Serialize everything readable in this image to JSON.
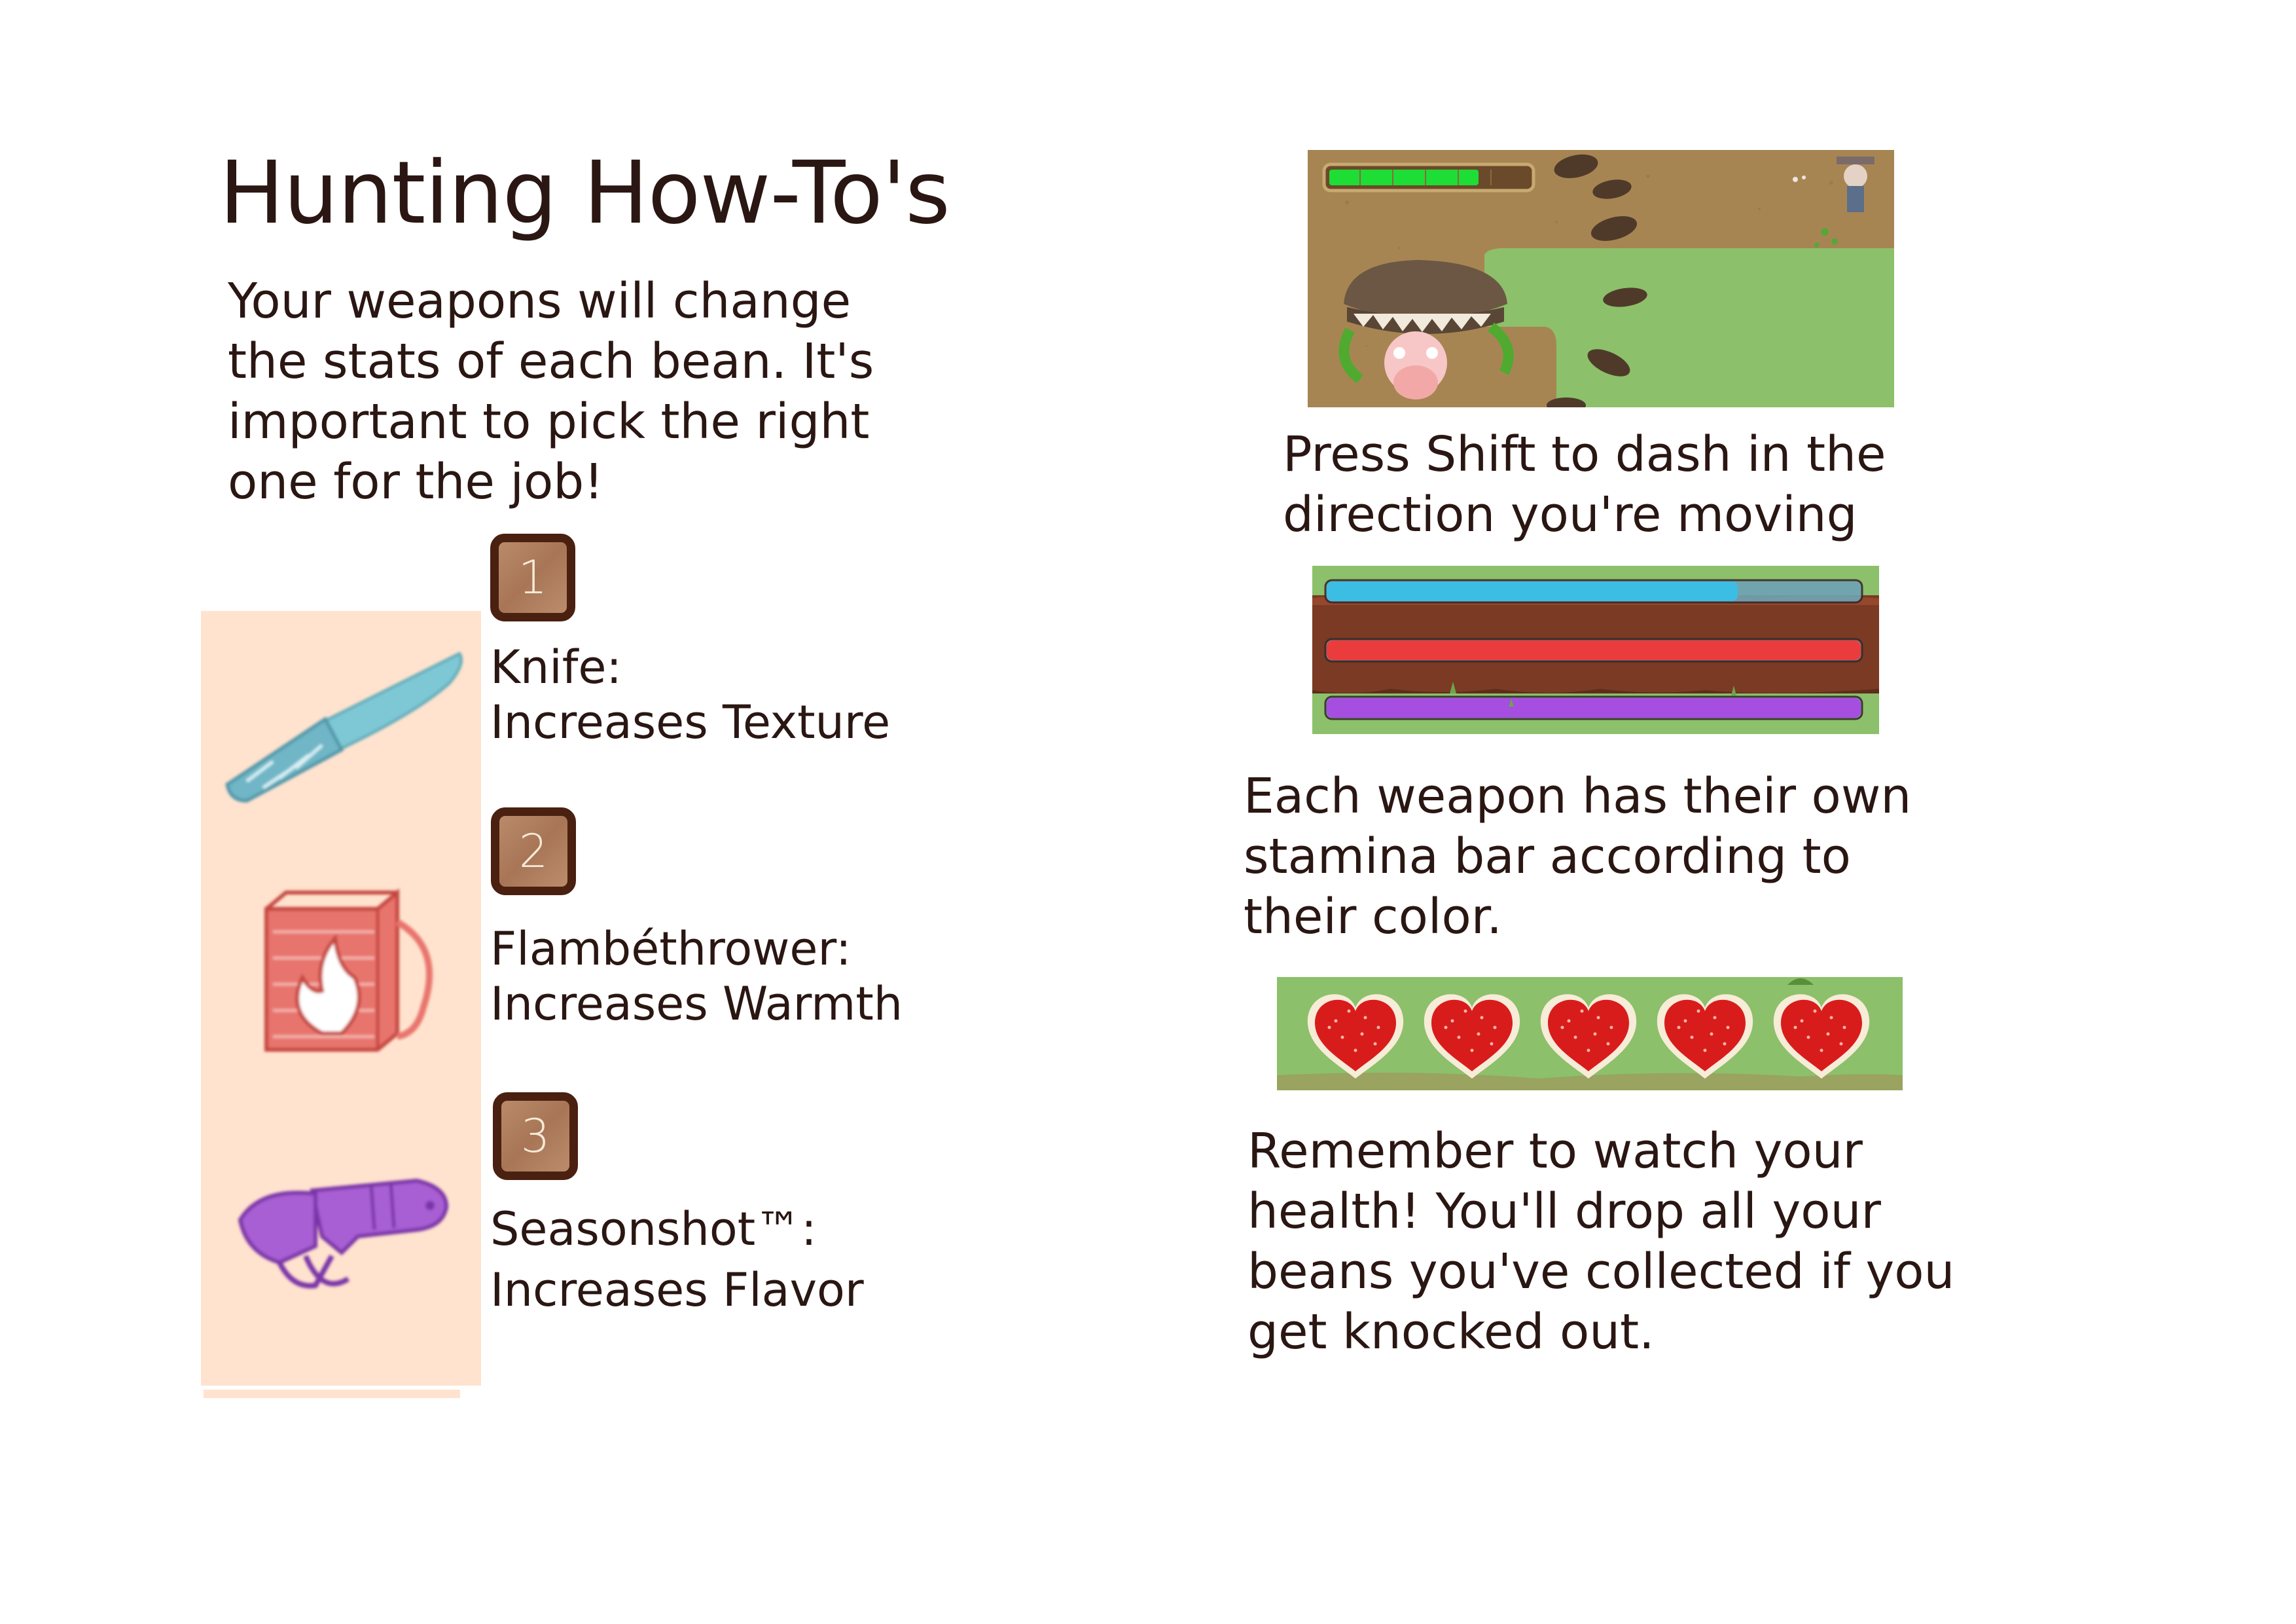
{
  "page": {
    "title": "Hunting How-To's",
    "intro": "Your weapons will change the stats of each bean. It's important to pick the right one for the job!"
  },
  "weapons": [
    {
      "number": "1",
      "name": "Knife:",
      "effect": "Increases Texture",
      "icon": "knife-icon",
      "color": "#7ec8d6"
    },
    {
      "number": "2",
      "name": "Flambéthrower:",
      "effect": "Increases Warmth",
      "icon": "flamethrower-icon",
      "color": "#e5625a"
    },
    {
      "number": "3",
      "name": "Seasonshot™:",
      "effect": "Increases Flavor",
      "icon": "seasonshot-icon",
      "color": "#a75fd3"
    }
  ],
  "tips": [
    {
      "caption": "Press Shift to dash in the direction you're moving"
    },
    {
      "caption": "Each weapon has their own stamina bar according to their color."
    },
    {
      "caption": "Remember to watch your health! You'll drop all your beans you've collected if you get knocked out."
    }
  ],
  "game_ui": {
    "dash_meter_fill": 0.75,
    "stamina_bars": [
      {
        "weapon": "Knife",
        "color": "#3bbde4",
        "level": 0.77
      },
      {
        "weapon": "Flambéthrower",
        "color": "#ea3c3c",
        "level": 1.0
      },
      {
        "weapon": "Seasonshot™",
        "color": "#a54ee0",
        "level": 1.0
      }
    ],
    "hearts": {
      "current": 5,
      "max": 5,
      "color": "#d81c1c"
    }
  },
  "colors": {
    "text": "#2a1612",
    "panel_bg": "#ffe3cf",
    "badge_border": "#4a2010",
    "badge_fill": "#a87656",
    "grass": "#8cc06a",
    "dirt": "#a78553"
  }
}
